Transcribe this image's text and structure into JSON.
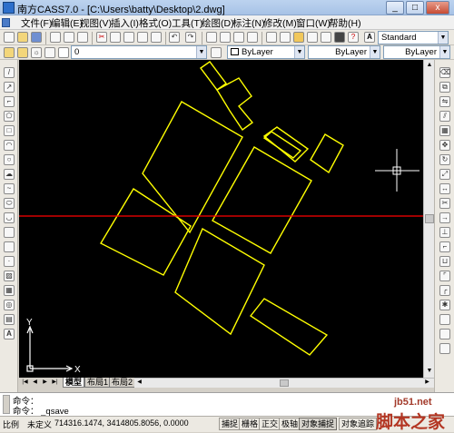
{
  "window": {
    "title": "南方CASS7.0 - [C:\\Users\\batty\\Desktop\\2.dwg]",
    "controls": [
      "_",
      "□",
      "x"
    ]
  },
  "menu": {
    "items": [
      "文件(F)",
      "编辑(E)",
      "视图(V)",
      "插入(I)",
      "格式(O)",
      "工具(T)",
      "绘图(D)",
      "标注(N)",
      "修改(M)",
      "窗口(W)",
      "帮助(H)"
    ]
  },
  "toolbar": {
    "text_style": "Standard",
    "layer": "0",
    "color": "ByLayer",
    "linetype": "ByLayer",
    "lineweight": "ByLayer"
  },
  "tabs": {
    "items": [
      "模型",
      "布局1",
      "布局2"
    ]
  },
  "command": {
    "line1": "命令：",
    "line2": "命令： _qsave"
  },
  "status": {
    "scale_label": "比例",
    "undefined_label": "未定义",
    "coordinates": "714316.1474, 3414805.8056, 0.0000",
    "toggles": [
      "捕捉",
      "栅格",
      "正交",
      "极轴",
      "对象捕捉",
      "对象追踪"
    ]
  },
  "ucs": {
    "x_label": "X",
    "y_label": "Y"
  },
  "watermark": {
    "site": "jb51.net",
    "name": "脚本之家"
  },
  "colors": {
    "canvas_bg": "#000000",
    "geometry": "#ffff00",
    "horizon_line": "#ff0000",
    "crosshair": "#ffffff"
  }
}
